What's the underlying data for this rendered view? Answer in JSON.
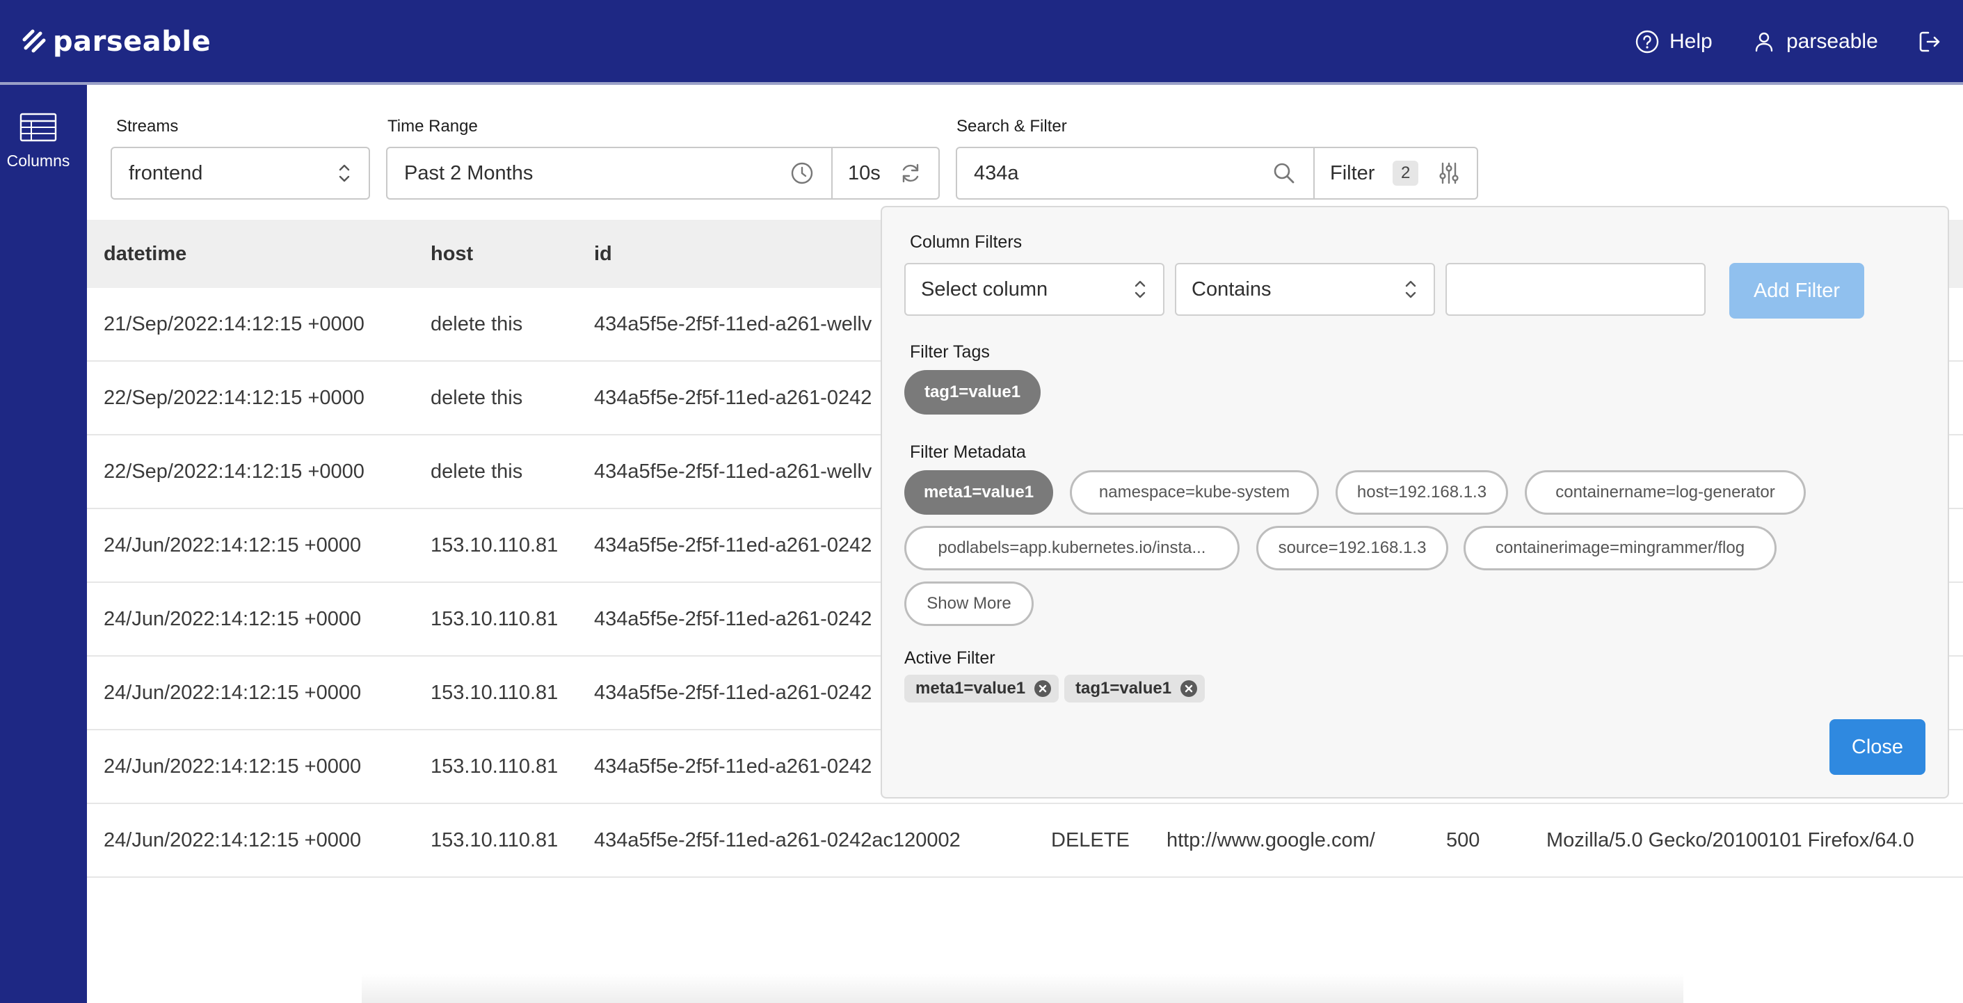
{
  "header": {
    "brand": "parseable",
    "help_label": "Help",
    "user_label": "parseable",
    "colors": {
      "primary": "#1e2884",
      "accent": "#2f89e0"
    }
  },
  "sidebar": {
    "columns_label": "Columns"
  },
  "controls": {
    "streams_label": "Streams",
    "streams_value": "frontend",
    "time_range_label": "Time Range",
    "time_range_value": "Past 2 Months",
    "refresh_interval": "10s",
    "search_label": "Search & Filter",
    "search_value": "434a",
    "filter_label": "Filter",
    "filter_count": "2"
  },
  "table": {
    "headers": [
      "datetime",
      "host",
      "id"
    ],
    "rows": [
      {
        "datetime": "21/Sep/2022:14:12:15 +0000",
        "host": "delete this",
        "id": "434a5f5e-2f5f-11ed-a261-wellv"
      },
      {
        "datetime": "22/Sep/2022:14:12:15 +0000",
        "host": "delete this",
        "id": "434a5f5e-2f5f-11ed-a261-0242"
      },
      {
        "datetime": "22/Sep/2022:14:12:15 +0000",
        "host": "delete this",
        "id": "434a5f5e-2f5f-11ed-a261-wellv"
      },
      {
        "datetime": "24/Jun/2022:14:12:15 +0000",
        "host": "153.10.110.81",
        "id": "434a5f5e-2f5f-11ed-a261-0242"
      },
      {
        "datetime": "24/Jun/2022:14:12:15 +0000",
        "host": "153.10.110.81",
        "id": "434a5f5e-2f5f-11ed-a261-0242"
      },
      {
        "datetime": "24/Jun/2022:14:12:15 +0000",
        "host": "153.10.110.81",
        "id": "434a5f5e-2f5f-11ed-a261-0242"
      },
      {
        "datetime": "24/Jun/2022:14:12:15 +0000",
        "host": "153.10.110.81",
        "id": "434a5f5e-2f5f-11ed-a261-0242"
      },
      {
        "datetime": "24/Jun/2022:14:12:15 +0000",
        "host": "153.10.110.81",
        "id": "434a5f5e-2f5f-11ed-a261-0242ac120002",
        "method": "DELETE",
        "url": "http://www.google.com/",
        "status": "500",
        "user_agent": "Mozilla/5.0 Gecko/20100101 Firefox/64.0"
      }
    ]
  },
  "filter_panel": {
    "column_filters_label": "Column Filters",
    "column_select_placeholder": "Select column",
    "operator_value": "Contains",
    "add_filter_label": "Add Filter",
    "filter_tags_label": "Filter Tags",
    "tags": [
      "tag1=value1"
    ],
    "filter_metadata_label": "Filter Metadata",
    "metadata": [
      "meta1=value1",
      "namespace=kube-system",
      "host=192.168.1.3",
      "containername=log-generator",
      "podlabels=app.kubernetes.io/insta...",
      "source=192.168.1.3",
      "containerimage=mingrammer/flog"
    ],
    "show_more_label": "Show More",
    "active_filter_label": "Active Filter",
    "active": [
      "meta1=value1",
      "tag1=value1"
    ],
    "close_label": "Close"
  }
}
